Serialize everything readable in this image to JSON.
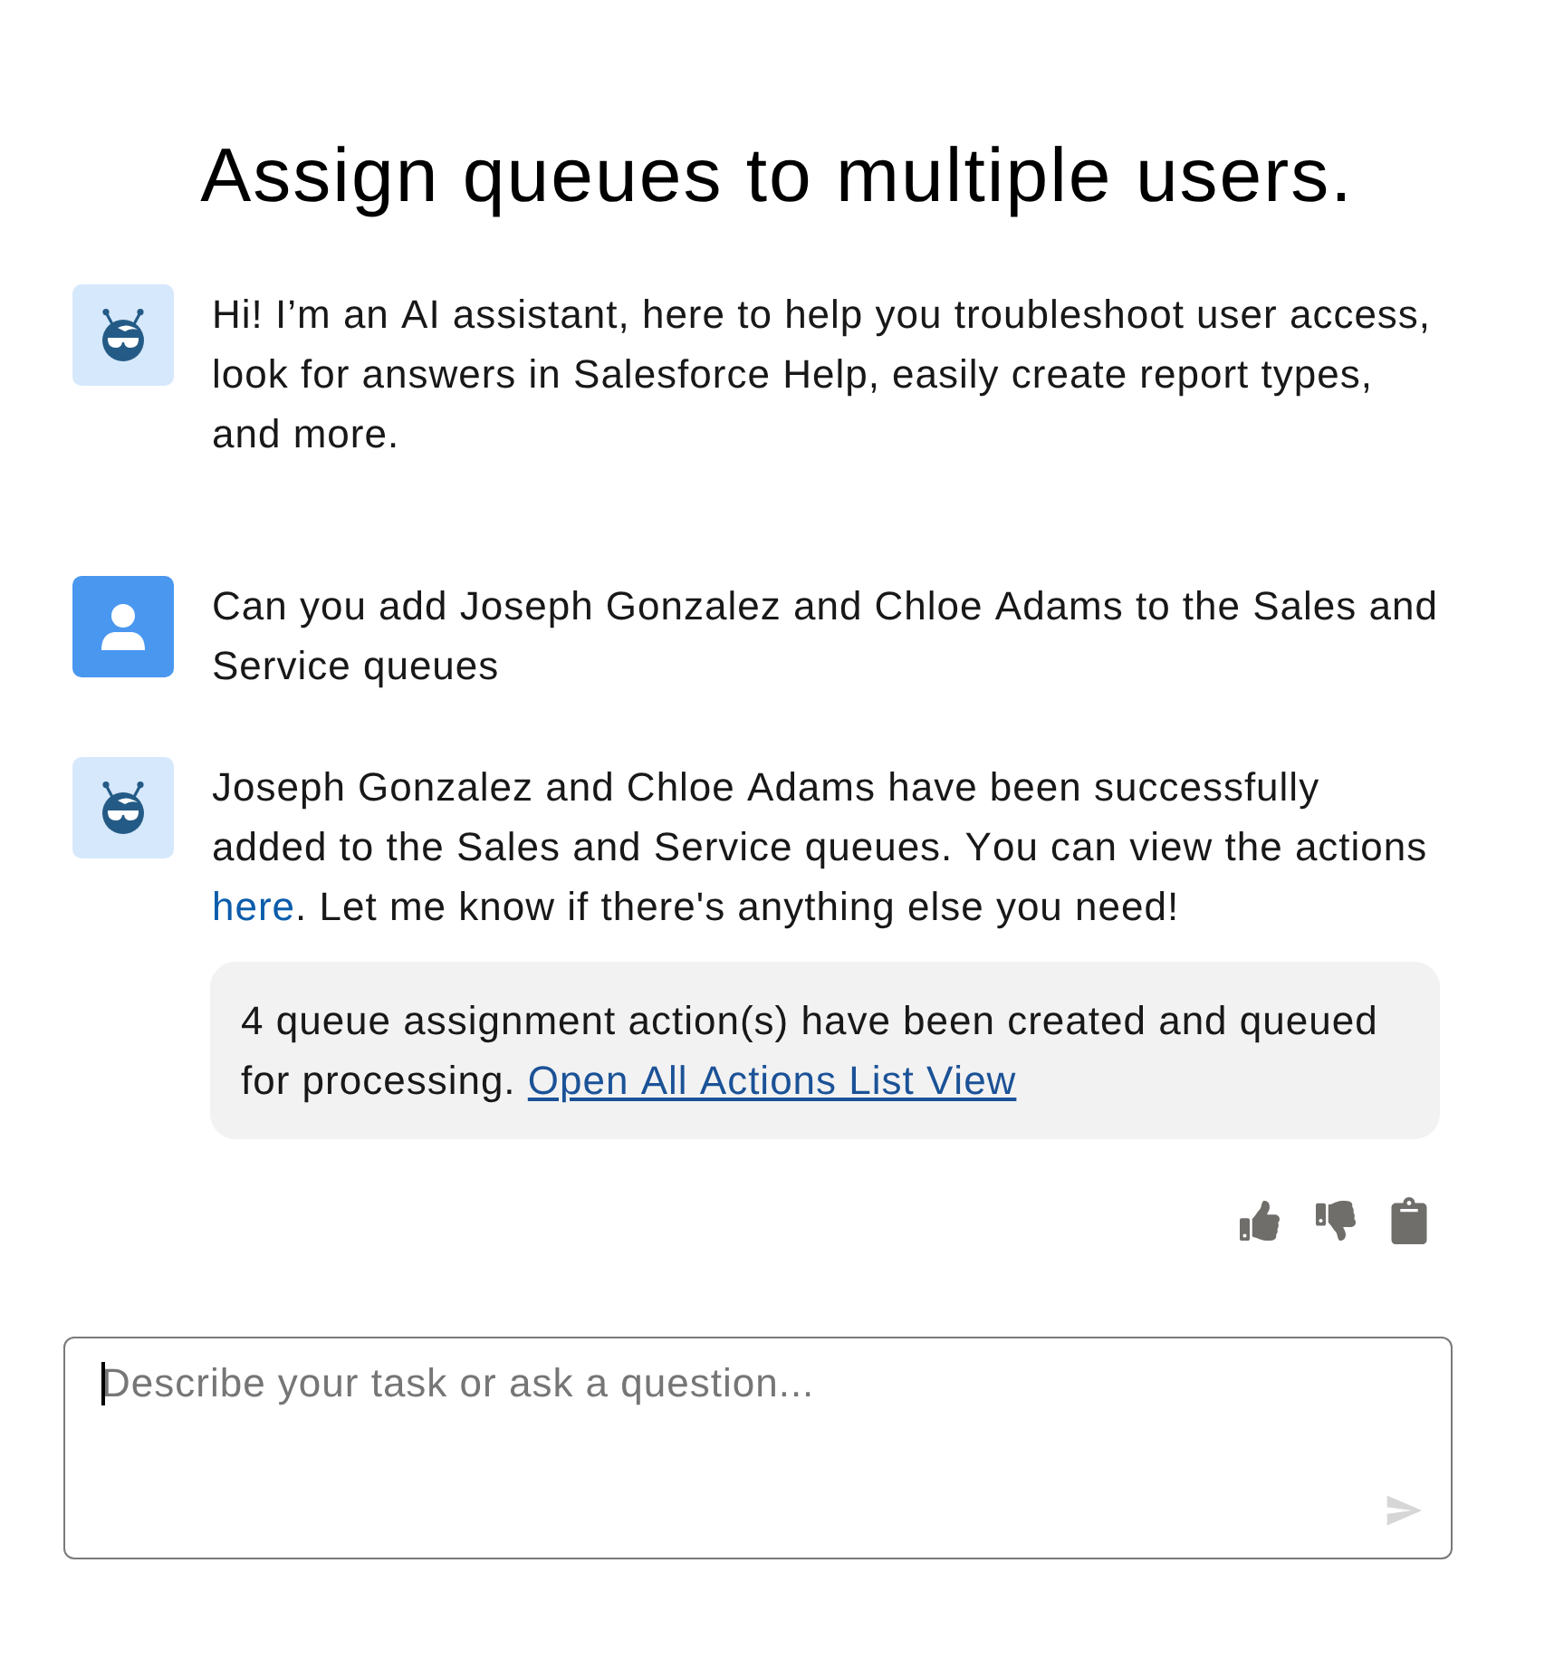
{
  "title": "Assign queues to multiple users.",
  "messages": [
    {
      "kind": "assistant",
      "segments": [
        {
          "kind": "text",
          "text": "Hi! I’m an AI assistant, here to help you troubleshoot user access, look for answers in Salesforce Help, easily create report types, and more."
        }
      ]
    },
    {
      "kind": "user",
      "segments": [
        {
          "kind": "text",
          "text": "Can you add Joseph Gonzalez and Chloe Adams to the Sales and Service queues"
        }
      ]
    },
    {
      "kind": "assistant",
      "segments": [
        {
          "kind": "text",
          "text": "Joseph Gonzalez and Chloe Adams have been successfully added to the Sales and Service queues. You can view the actions "
        },
        {
          "kind": "link",
          "text": "here"
        },
        {
          "kind": "text",
          "text": ". Let me know if there's anything else you need!"
        }
      ],
      "card": {
        "segments": [
          {
            "kind": "text",
            "text": "4 queue assignment action(s) have been created and queued for processing. "
          },
          {
            "kind": "link",
            "text": "Open All Actions List View"
          }
        ]
      },
      "feedback": true
    }
  ],
  "composer": {
    "placeholder": "Describe your task or ask a question...",
    "focused": true,
    "send_disabled": true
  }
}
